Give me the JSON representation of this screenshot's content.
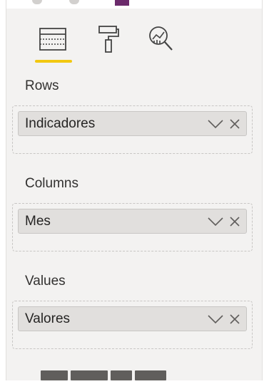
{
  "tabs": [
    {
      "name": "build-visual",
      "icon": "table-grid-icon",
      "active": true
    },
    {
      "name": "format",
      "icon": "paint-roller-icon",
      "active": false
    },
    {
      "name": "analytics",
      "icon": "magnifier-chart-icon",
      "active": false
    }
  ],
  "wells": [
    {
      "label": "Rows",
      "field": "Indicadores"
    },
    {
      "label": "Columns",
      "field": "Mes"
    },
    {
      "label": "Values",
      "field": "Valores"
    }
  ],
  "colors": {
    "pane_bg": "#f3f2f1",
    "active_tab_underline": "#f2c811",
    "pill_bg": "#e1dfdd",
    "top_accent": "#6b2a6b"
  }
}
